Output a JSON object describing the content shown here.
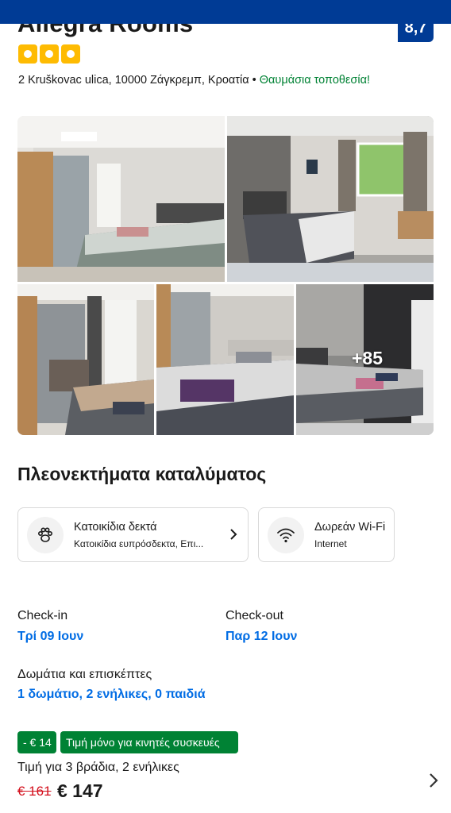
{
  "hotel": {
    "name": "Allegra Rooms",
    "score": "8,7",
    "star_count": 3,
    "address": "2 Kruškovac ulica, 10000 Ζάγκρεμπ, Κροατία",
    "address_separator": " • ",
    "location_note": "Θαυμάσια τοποθεσία!"
  },
  "gallery": {
    "more_photos": "+85"
  },
  "amenities": {
    "title": "Πλεονεκτήματα καταλύματος",
    "items": [
      {
        "icon": "paw-icon",
        "title": "Κατοικίδια δεκτά",
        "subtitle": "Κατοικίδια ευπρόσδεκτα, Επι..."
      },
      {
        "icon": "wifi-icon",
        "title": "Δωρεάν Wi-Fi",
        "subtitle": "Internet"
      }
    ]
  },
  "booking": {
    "checkin_label": "Check-in",
    "checkin_value": "Τρί 09 Ιουν",
    "checkout_label": "Check-out",
    "checkout_value": "Παρ 12 Ιουν",
    "rooms_label": "Δωμάτια και επισκέπτες",
    "rooms_value": "1 δωμάτιο, 2 ενήλικες, 0 παιδιά"
  },
  "price": {
    "discount_badge": "- € 14",
    "mobile_badge": "Τιμή μόνο για κινητές συσκευές",
    "price_for": "Τιμή για 3 βράδια, 2 ενήλικες",
    "old_price": "€ 161",
    "new_price": "€ 147"
  },
  "colors": {
    "brand_blue": "#003b95",
    "link_blue": "#006ce4",
    "star_yellow": "#febb02",
    "deal_green": "#008234",
    "strike_red": "#d4111e"
  }
}
